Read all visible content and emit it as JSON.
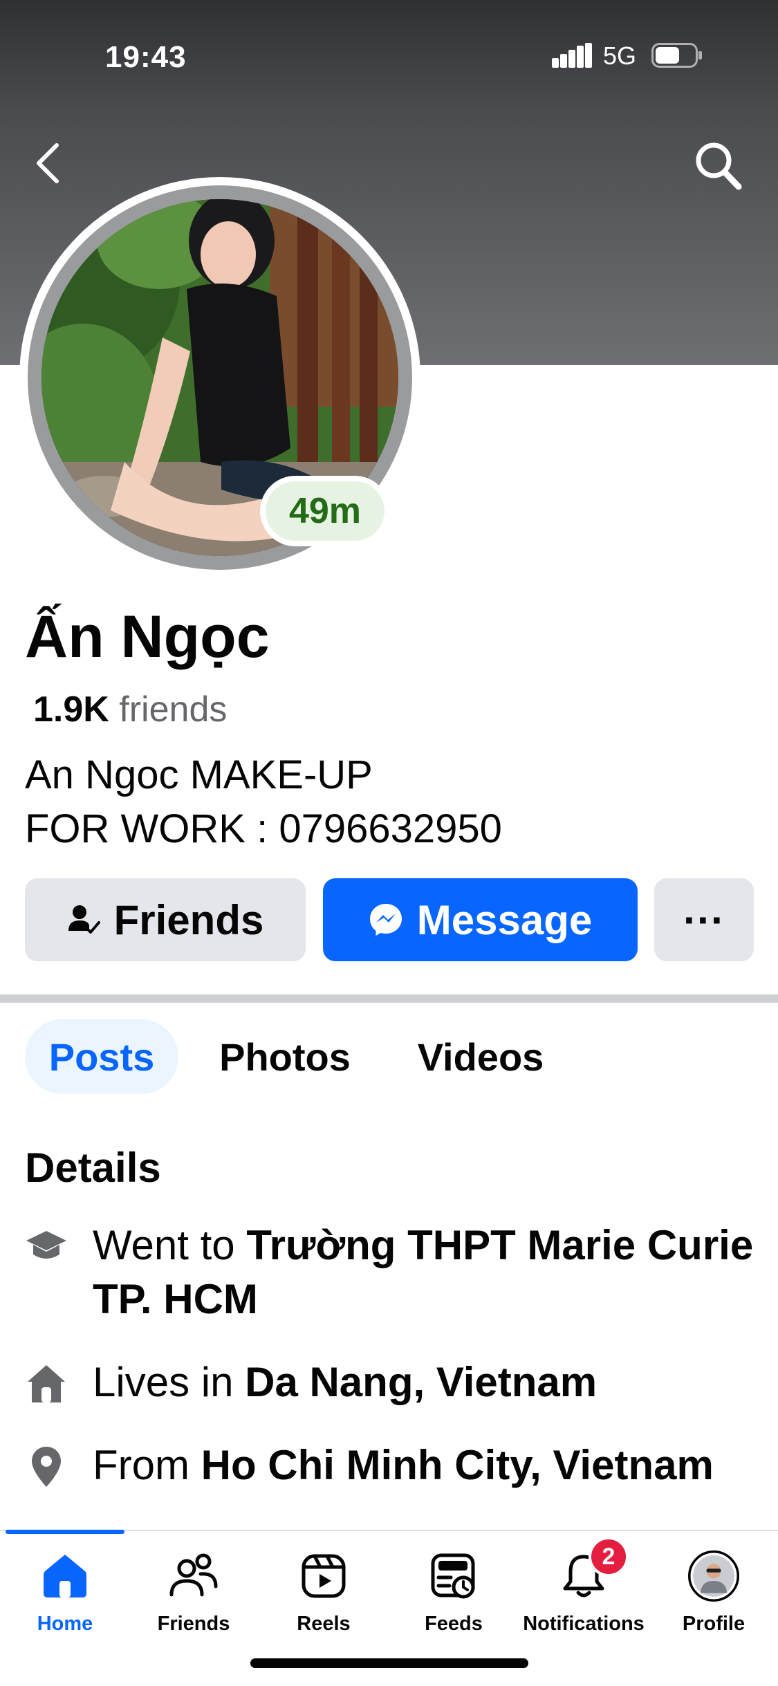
{
  "status_bar": {
    "time": "19:43",
    "network": "5G"
  },
  "header": {
    "back_icon": "chevron-left-icon",
    "search_icon": "search-icon"
  },
  "profile": {
    "active_badge": "49m",
    "name": "Ấn Ngọc",
    "friends_count": "1.9K",
    "friends_label": " friends",
    "bio": [
      "An Ngoc MAKE-UP",
      "FOR WORK : 0796632950"
    ]
  },
  "actions": {
    "friends_label": "Friends",
    "message_label": "Message",
    "more_label": "···"
  },
  "tabs": [
    {
      "label": "Posts",
      "active": true
    },
    {
      "label": "Photos",
      "active": false
    },
    {
      "label": "Videos",
      "active": false
    }
  ],
  "details": {
    "title": "Details",
    "items": [
      {
        "icon": "graduation-cap-icon",
        "prefix": "Went to ",
        "value": "Trường THPT Marie Curie TP. HCM"
      },
      {
        "icon": "home-icon",
        "prefix": "Lives in ",
        "value": "Da Nang, Vietnam"
      },
      {
        "icon": "location-pin-icon",
        "prefix": "From ",
        "value": "Ho Chi Minh City, Vietnam"
      }
    ]
  },
  "bottom_nav": {
    "items": [
      {
        "label": "Home",
        "icon": "home-icon",
        "active": true
      },
      {
        "label": "Friends",
        "icon": "friends-icon",
        "active": false
      },
      {
        "label": "Reels",
        "icon": "reels-icon",
        "active": false
      },
      {
        "label": "Feeds",
        "icon": "feeds-icon",
        "active": false
      },
      {
        "label": "Notifications",
        "icon": "bell-icon",
        "active": false,
        "badge": "2"
      },
      {
        "label": "Profile",
        "icon": "profile-avatar",
        "active": false
      }
    ]
  },
  "colors": {
    "accent": "#0866ff",
    "active_green": "#236b16",
    "notification_red": "#e41e3f"
  }
}
